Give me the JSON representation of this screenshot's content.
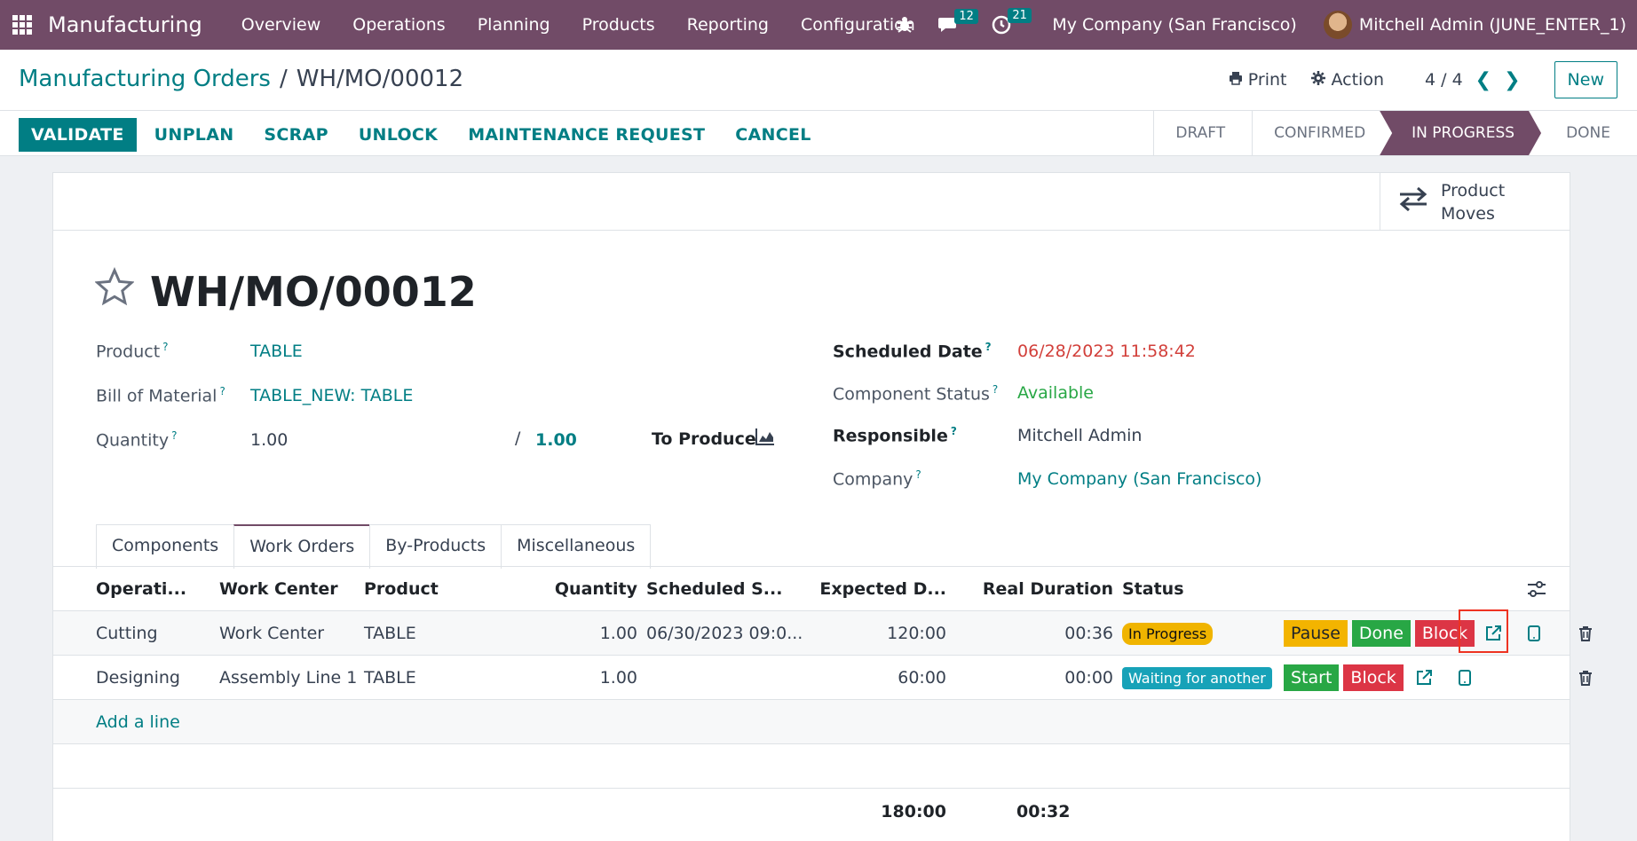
{
  "navbar": {
    "app_name": "Manufacturing",
    "menu": [
      "Overview",
      "Operations",
      "Planning",
      "Products",
      "Reporting",
      "Configuration"
    ],
    "messages_count": "12",
    "activities_count": "21",
    "company": "My Company (San Francisco)",
    "user": "Mitchell Admin (JUNE_ENTER_1)"
  },
  "control": {
    "breadcrumb_parent": "Manufacturing Orders",
    "breadcrumb_sep": "/",
    "breadcrumb_current": "WH/MO/00012",
    "print_label": "Print",
    "action_label": "Action",
    "pager": "4 / 4",
    "new_label": "New"
  },
  "statusbar": {
    "actions": [
      "VALIDATE",
      "UNPLAN",
      "SCRAP",
      "UNLOCK",
      "MAINTENANCE REQUEST",
      "CANCEL"
    ],
    "stages": [
      "DRAFT",
      "CONFIRMED",
      "IN PROGRESS",
      "DONE"
    ],
    "active_stage": "IN PROGRESS"
  },
  "smart_button": {
    "line1": "Product",
    "line2": "Moves"
  },
  "record": {
    "title": "WH/MO/00012",
    "product_label": "Product",
    "product": "TABLE",
    "bom_label": "Bill of Material",
    "bom": "TABLE_NEW: TABLE",
    "quantity_label": "Quantity",
    "quantity": "1.00",
    "qty_sep": "/",
    "qty_to_produce": "1.00",
    "to_produce_label": "To Produce",
    "scheduled_date_label": "Scheduled Date",
    "scheduled_date": "06/28/2023 11:58:42",
    "component_status_label": "Component Status",
    "component_status": "Available",
    "responsible_label": "Responsible",
    "responsible": "Mitchell Admin",
    "company_label": "Company",
    "company": "My Company (San Francisco)"
  },
  "tabs": [
    "Components",
    "Work Orders",
    "By-Products",
    "Miscellaneous"
  ],
  "active_tab": "Work Orders",
  "work_orders": {
    "headers": [
      "Operati...",
      "Work Center",
      "Product",
      "Quantity",
      "Scheduled S...",
      "Expected D...",
      "Real Duration",
      "Status"
    ],
    "rows": [
      {
        "operation": "Cutting",
        "work_center": "Work Center",
        "product": "TABLE",
        "quantity": "1.00",
        "scheduled": "06/30/2023 09:0...",
        "expected": "120:00",
        "real": "00:36",
        "status": "In Progress",
        "buttons": [
          "Pause",
          "Done",
          "Block"
        ]
      },
      {
        "operation": "Designing",
        "work_center": "Assembly Line 1",
        "product": "TABLE",
        "quantity": "1.00",
        "scheduled": "",
        "expected": "60:00",
        "real": "00:00",
        "status": "Waiting for another",
        "buttons": [
          "Start",
          "Block"
        ]
      }
    ],
    "add_line": "Add a line",
    "total_expected": "180:00",
    "total_real": "00:32"
  },
  "colors": {
    "brand": "#714b67",
    "accent": "#017e84"
  }
}
